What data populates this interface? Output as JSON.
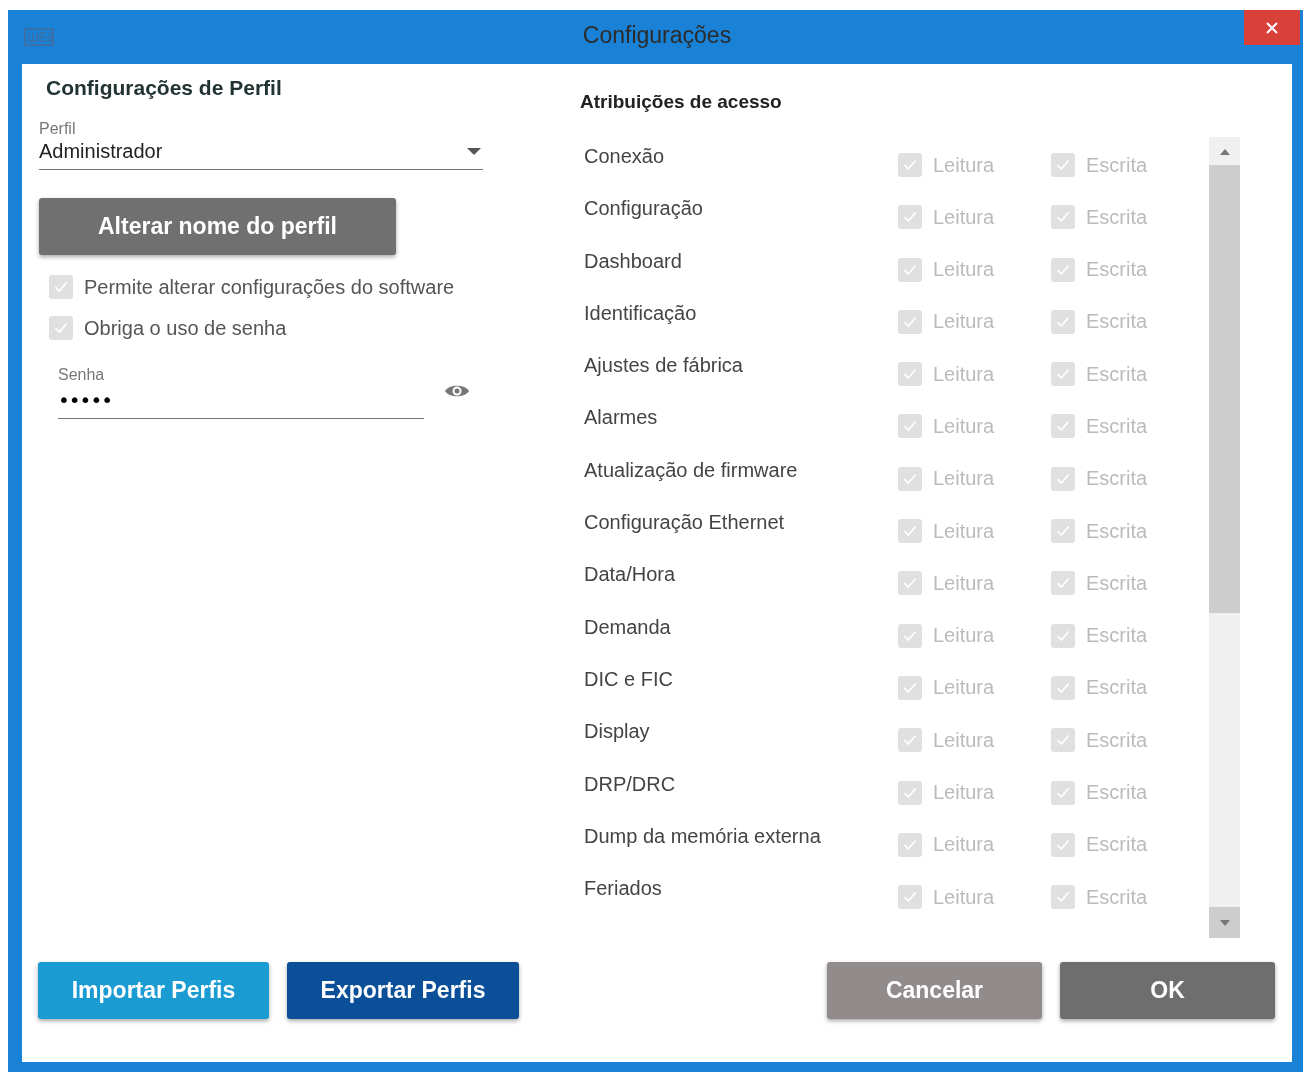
{
  "window": {
    "title": "Configurações"
  },
  "profile": {
    "heading": "Configurações de Perfil",
    "field_label": "Perfil",
    "value": "Administrador",
    "rename_button": "Alterar nome do perfil",
    "options": [
      {
        "label": "Permite alterar configurações do software",
        "checked": true,
        "disabled": true
      },
      {
        "label": "Obriga o uso de senha",
        "checked": true,
        "disabled": true
      }
    ],
    "password": {
      "label": "Senha",
      "value": "•••••"
    }
  },
  "access": {
    "heading": "Atribuições de acesso",
    "rows": [
      {
        "name": "Conexão",
        "read": {
          "label": "Leitura",
          "checked": true,
          "disabled": true
        },
        "write": {
          "label": "Escrita",
          "checked": true,
          "disabled": true
        }
      },
      {
        "name": "Configuração",
        "read": {
          "label": "Leitura",
          "checked": true,
          "disabled": true
        },
        "write": {
          "label": "Escrita",
          "checked": true,
          "disabled": true
        }
      },
      {
        "name": "Dashboard",
        "read": {
          "label": "Leitura",
          "checked": true,
          "disabled": true
        },
        "write": {
          "label": "Escrita",
          "checked": true,
          "disabled": true
        }
      },
      {
        "name": "Identificação",
        "read": {
          "label": "Leitura",
          "checked": true,
          "disabled": true
        },
        "write": {
          "label": "Escrita",
          "checked": true,
          "disabled": true
        }
      },
      {
        "name": "Ajustes de fábrica",
        "read": {
          "label": "Leitura",
          "checked": true,
          "disabled": true
        },
        "write": {
          "label": "Escrita",
          "checked": true,
          "disabled": true
        }
      },
      {
        "name": "Alarmes",
        "read": {
          "label": "Leitura",
          "checked": true,
          "disabled": true
        },
        "write": {
          "label": "Escrita",
          "checked": true,
          "disabled": true
        }
      },
      {
        "name": "Atualização de firmware",
        "read": {
          "label": "Leitura",
          "checked": true,
          "disabled": true
        },
        "write": {
          "label": "Escrita",
          "checked": true,
          "disabled": true
        }
      },
      {
        "name": "Configuração Ethernet",
        "read": {
          "label": "Leitura",
          "checked": true,
          "disabled": true
        },
        "write": {
          "label": "Escrita",
          "checked": true,
          "disabled": true
        }
      },
      {
        "name": "Data/Hora",
        "read": {
          "label": "Leitura",
          "checked": true,
          "disabled": true
        },
        "write": {
          "label": "Escrita",
          "checked": true,
          "disabled": true
        }
      },
      {
        "name": "Demanda",
        "read": {
          "label": "Leitura",
          "checked": true,
          "disabled": true
        },
        "write": {
          "label": "Escrita",
          "checked": true,
          "disabled": true
        }
      },
      {
        "name": "DIC e FIC",
        "read": {
          "label": "Leitura",
          "checked": true,
          "disabled": true
        },
        "write": {
          "label": "Escrita",
          "checked": true,
          "disabled": true
        }
      },
      {
        "name": "Display",
        "read": {
          "label": "Leitura",
          "checked": true,
          "disabled": true
        },
        "write": {
          "label": "Escrita",
          "checked": true,
          "disabled": true
        }
      },
      {
        "name": "DRP/DRC",
        "read": {
          "label": "Leitura",
          "checked": true,
          "disabled": true
        },
        "write": {
          "label": "Escrita",
          "checked": true,
          "disabled": true
        }
      },
      {
        "name": "Dump da memória externa",
        "read": {
          "label": "Leitura",
          "checked": true,
          "disabled": true
        },
        "write": {
          "label": "Escrita",
          "checked": true,
          "disabled": true
        }
      },
      {
        "name": "Feriados",
        "read": {
          "label": "Leitura",
          "checked": true,
          "disabled": true
        },
        "write": {
          "label": "Escrita",
          "checked": true,
          "disabled": true
        }
      }
    ]
  },
  "buttons": [
    {
      "label": "Importar Perfis",
      "kind": "import"
    },
    {
      "label": "Exportar Perfis",
      "kind": "export"
    },
    {
      "label": "Cancelar",
      "kind": "cancel"
    },
    {
      "label": "OK",
      "kind": "ok"
    }
  ]
}
